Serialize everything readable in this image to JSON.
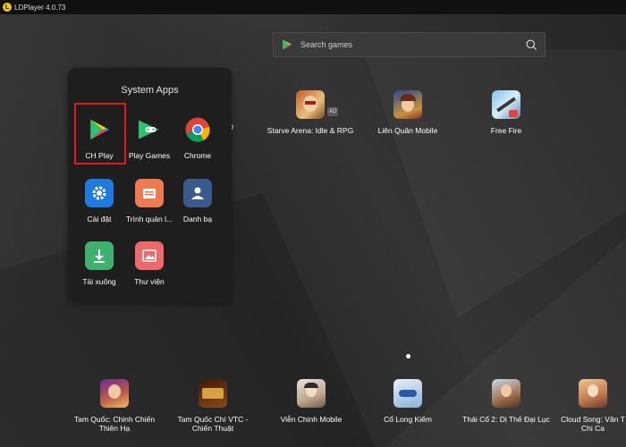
{
  "window": {
    "title": "LDPlayer 4.0.73"
  },
  "search": {
    "placeholder": "Search games"
  },
  "folder": {
    "title": "System Apps",
    "apps": [
      {
        "label": "CH Play",
        "icon": "play-store-icon"
      },
      {
        "label": "Play Games",
        "icon": "play-games-icon"
      },
      {
        "label": "Chrome",
        "icon": "chrome-icon"
      },
      {
        "label": "Cài đặt",
        "icon": "settings-gear-icon"
      },
      {
        "label": "Trình quản l...",
        "icon": "file-manager-icon"
      },
      {
        "label": "Danh bạ",
        "icon": "contacts-icon"
      },
      {
        "label": "Tải xuống",
        "icon": "download-icon"
      },
      {
        "label": "Thư viện",
        "icon": "gallery-icon"
      }
    ]
  },
  "peek_text": "D",
  "top_games": [
    {
      "label": "Starve Arena: Idle & RPG",
      "badge": "AD"
    },
    {
      "label": "Liên Quân Mobile"
    },
    {
      "label": "Free Fire"
    }
  ],
  "bottom_games": [
    {
      "line1": "Tam Quốc: Chinh Chiến",
      "line2": "Thiên Hạ"
    },
    {
      "line1": "Tam Quốc Chí VTC -",
      "line2": "Chiến Thuật"
    },
    {
      "line1": "Viễn Chinh Mobile",
      "line2": ""
    },
    {
      "line1": "Cổ Long Kiếm",
      "line2": ""
    },
    {
      "line1": "Thái Cổ 2: Dị Thế Đại Lục",
      "line2": ""
    },
    {
      "line1": "Cloud Song: Vân T",
      "line2": "Chi Ca"
    }
  ],
  "colors": {
    "highlight": "#e21b1b",
    "folder_bg": "#1e1e1e"
  }
}
